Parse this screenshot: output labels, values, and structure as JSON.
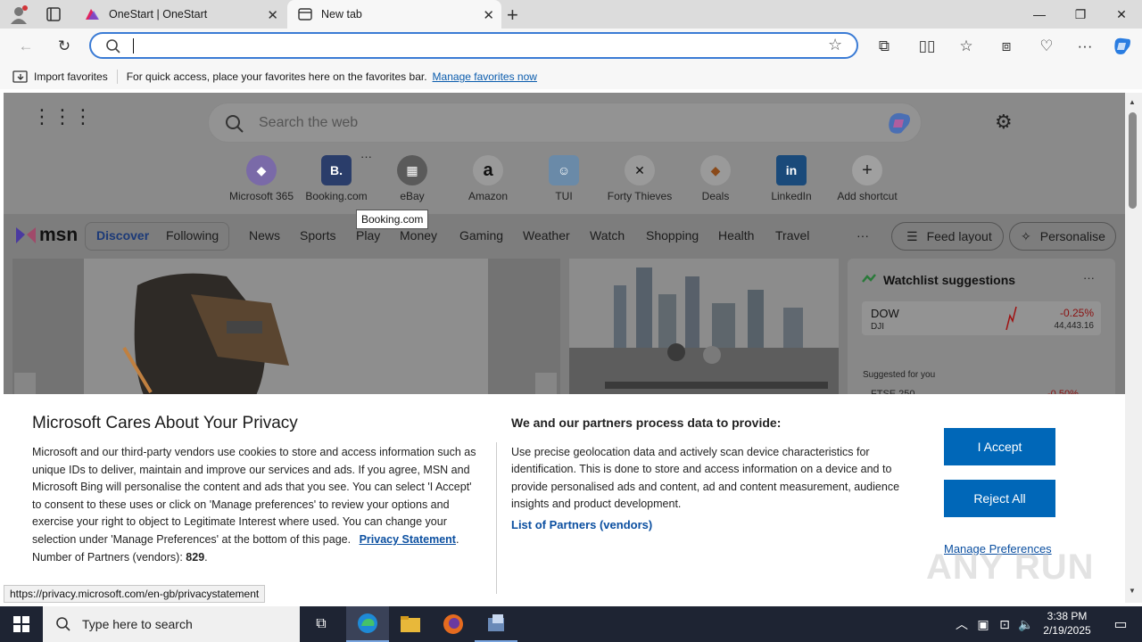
{
  "tabs": [
    {
      "title": "OneStart | OneStart"
    },
    {
      "title": "New tab"
    }
  ],
  "favbar": {
    "import_label": "Import favorites",
    "hint": "For quick access, place your favorites here on the favorites bar.",
    "manage_link": "Manage favorites now"
  },
  "newtab": {
    "search_placeholder": "Search the web",
    "shortcuts": [
      {
        "label": "Microsoft 365",
        "glyph": "◆"
      },
      {
        "label": "Booking.com",
        "glyph": "B."
      },
      {
        "label": "eBay",
        "glyph": "▦"
      },
      {
        "label": "Amazon",
        "glyph": "a"
      },
      {
        "label": "TUI",
        "glyph": "☺"
      },
      {
        "label": "Forty Thieves",
        "glyph": "✕"
      },
      {
        "label": "Deals",
        "glyph": "◆"
      },
      {
        "label": "LinkedIn",
        "glyph": "in"
      },
      {
        "label": "Add shortcut",
        "glyph": "+"
      }
    ],
    "tooltip": "Booking.com"
  },
  "msn": {
    "logo": "msn",
    "tabs": [
      "Discover",
      "Following"
    ],
    "nav": [
      "News",
      "Sports",
      "Play",
      "Money",
      "Gaming",
      "Weather",
      "Watch",
      "Shopping",
      "Health",
      "Travel"
    ],
    "more": "···",
    "feed_layout": "Feed layout",
    "personalise": "Personalise"
  },
  "watchlist": {
    "title": "Watchlist suggestions",
    "menu": "···",
    "stock": {
      "name": "DOW",
      "sub": "DJI",
      "change": "-0.25%",
      "value": "44,443.16"
    },
    "suggested": "Suggested for you",
    "partial": "FTSE 250",
    "partial_change": "-0.50%"
  },
  "privacy": {
    "title": "Microsoft Cares About Your Privacy",
    "body": "Microsoft and our third-party vendors use cookies to store and access information such as unique IDs to deliver, maintain and improve our services and ads. If you agree, MSN and Microsoft Bing will personalise the content and ads that you see. You can select 'I Accept' to consent to these uses or click on 'Manage preferences' to review your options and exercise your right to object to Legitimate Interest where used.  You can change your selection under 'Manage Preferences' at the bottom of this page.",
    "privacy_link": "Privacy Statement",
    "partners_label": "Number of Partners (vendors):",
    "partners_count": "829",
    "right_title": "We and our partners process data to provide:",
    "right_body": "Use precise geolocation data and actively scan device characteristics for identification. This is done to store and access information on a device and to provide personalised ads and content, ad and content measurement, audience insights and product development.",
    "list_link": "List of Partners (vendors)",
    "accept": "I Accept",
    "reject": "Reject All",
    "manage": "Manage Preferences"
  },
  "status_url": "https://privacy.microsoft.com/en-gb/privacystatement",
  "watermark": "ANY RUN",
  "taskbar": {
    "search_placeholder": "Type here to search",
    "time": "3:38 PM",
    "date": "2/19/2025"
  }
}
